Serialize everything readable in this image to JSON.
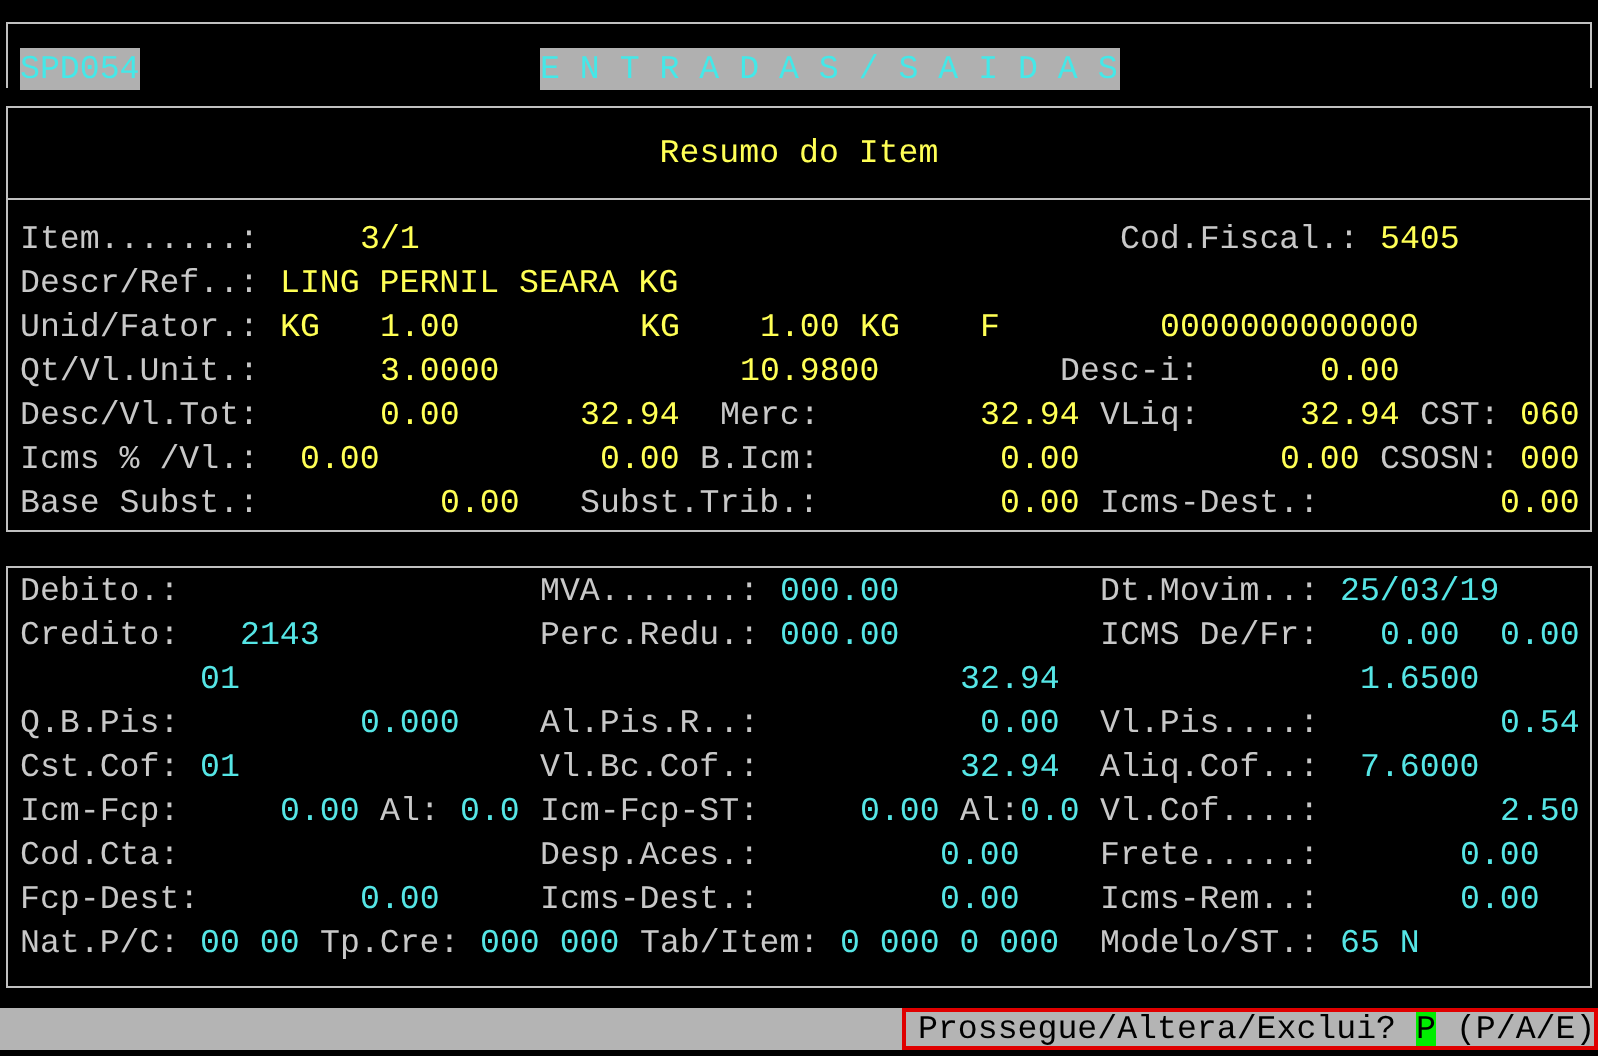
{
  "header": {
    "program_code": "SPD054",
    "title": "E N T R A D A S / S A I D A S"
  },
  "summary_title": "Resumo do Item",
  "sections": [
    {
      "kind": "summary",
      "lines": [
        {
          "left": [
            {
              "kind": "label",
              "text": "Item.......:"
            },
            {
              "kind": "value",
              "text": "3/1"
            }
          ],
          "right": [
            {
              "kind": "label",
              "text": "Cod.Fiscal.:"
            },
            {
              "kind": "value",
              "text": "5405"
            }
          ]
        },
        {
          "left": [
            {
              "kind": "label",
              "text": "Descr/Ref..:"
            },
            {
              "kind": "value",
              "text": "LING PERNIL SEARA KG"
            }
          ]
        },
        {
          "left": [
            {
              "kind": "label",
              "text": "Unid/Fator.:"
            },
            {
              "kind": "value",
              "text": "KG"
            },
            {
              "kind": "value",
              "text": "1.00"
            }
          ],
          "center": [
            {
              "kind": "value",
              "text": "KG"
            },
            {
              "kind": "value",
              "text": "1.00"
            },
            {
              "kind": "value",
              "text": "KG"
            }
          ],
          "right": [
            {
              "kind": "value",
              "text": "F"
            },
            {
              "kind": "value",
              "text": "0000000000000"
            }
          ]
        },
        {
          "left": [
            {
              "kind": "label",
              "text": "Qt/Vl.Unit.:"
            },
            {
              "kind": "value",
              "text": "3.0000"
            }
          ],
          "center": [
            {
              "kind": "value",
              "text": "10.9800"
            }
          ],
          "right": [
            {
              "kind": "label",
              "text": "Desc-i:"
            },
            {
              "kind": "value",
              "text": "0.00"
            }
          ]
        },
        {
          "left": [
            {
              "kind": "label",
              "text": "Desc/Vl.Tot:"
            },
            {
              "kind": "value",
              "text": "0.00"
            },
            {
              "kind": "value",
              "text": "32.94"
            }
          ],
          "center": [
            {
              "kind": "label",
              "text": "Merc:"
            },
            {
              "kind": "value",
              "text": "32.94"
            }
          ],
          "right": [
            {
              "kind": "label",
              "text": "VLiq:"
            },
            {
              "kind": "value",
              "text": "32.94"
            },
            {
              "kind": "label",
              "text": "CST:"
            },
            {
              "kind": "value",
              "text": "060"
            }
          ]
        },
        {
          "left": [
            {
              "kind": "label",
              "text": "Icms % /Vl.:"
            },
            {
              "kind": "value",
              "text": "0.00"
            },
            {
              "kind": "value",
              "text": "0.00"
            }
          ],
          "center": [
            {
              "kind": "label",
              "text": "B.Icm:"
            },
            {
              "kind": "value",
              "text": "0.00"
            }
          ],
          "right": [
            {
              "kind": "value",
              "text": "0.00"
            },
            {
              "kind": "label",
              "text": "CSOSN:"
            },
            {
              "kind": "value",
              "text": "000"
            }
          ]
        },
        {
          "left": [
            {
              "kind": "label",
              "text": "Base Subst.:"
            },
            {
              "kind": "value",
              "text": "0.00"
            }
          ],
          "center": [
            {
              "kind": "label",
              "text": "Subst.Trib.:"
            },
            {
              "kind": "value",
              "text": "0.00"
            }
          ],
          "right": [
            {
              "kind": "label",
              "text": "Icms-Dest.:"
            },
            {
              "kind": "value",
              "text": "0.00"
            }
          ]
        }
      ]
    },
    {
      "kind": "taxes",
      "lines": [
        {
          "left": [
            {
              "kind": "label",
              "text": "Debito.:"
            }
          ],
          "center": [
            {
              "kind": "label",
              "text": "MVA.......:"
            },
            {
              "kind": "value",
              "text": "000.00"
            }
          ],
          "right": [
            {
              "kind": "label",
              "text": "Dt.Movim..:"
            },
            {
              "kind": "value",
              "text": "25/03/19"
            }
          ]
        },
        {
          "left": [
            {
              "kind": "label",
              "text": "Credito:"
            },
            {
              "kind": "value",
              "text": "2143"
            }
          ],
          "center": [
            {
              "kind": "label",
              "text": "Perc.Redu.:"
            },
            {
              "kind": "value",
              "text": "000.00"
            }
          ],
          "right": [
            {
              "kind": "label",
              "text": "ICMS De/Fr:"
            },
            {
              "kind": "value",
              "text": "0.00"
            },
            {
              "kind": "value",
              "text": "0.00"
            }
          ]
        },
        {
          "left": [
            {
              "kind": "value",
              "text": "01"
            }
          ],
          "center": [
            {
              "kind": "value",
              "text": "32.94"
            }
          ],
          "right": [
            {
              "kind": "value",
              "text": "1.6500"
            }
          ]
        },
        {
          "left": [
            {
              "kind": "label",
              "text": "Q.B.Pis:"
            },
            {
              "kind": "value",
              "text": "0.000"
            }
          ],
          "center": [
            {
              "kind": "label",
              "text": "Al.Pis.R..:"
            },
            {
              "kind": "value",
              "text": "0.00"
            }
          ],
          "right": [
            {
              "kind": "label",
              "text": "Vl.Pis....:"
            },
            {
              "kind": "value",
              "text": "0.54"
            }
          ]
        },
        {
          "left": [
            {
              "kind": "label",
              "text": "Cst.Cof:"
            },
            {
              "kind": "value",
              "text": "01"
            }
          ],
          "center": [
            {
              "kind": "label",
              "text": "Vl.Bc.Cof.:"
            },
            {
              "kind": "value",
              "text": "32.94"
            }
          ],
          "right": [
            {
              "kind": "label",
              "text": "Aliq.Cof..:"
            },
            {
              "kind": "value",
              "text": "7.6000"
            }
          ]
        },
        {
          "left": [
            {
              "kind": "label",
              "text": "Icm-Fcp:"
            },
            {
              "kind": "value",
              "text": "0.00"
            },
            {
              "kind": "label",
              "text": "Al:"
            },
            {
              "kind": "value",
              "text": "0.0"
            }
          ],
          "center": [
            {
              "kind": "label",
              "text": "Icm-Fcp-ST:"
            },
            {
              "kind": "value",
              "text": "0.00"
            },
            {
              "kind": "label",
              "text": "Al:"
            },
            {
              "kind": "value",
              "text": "0.0"
            }
          ],
          "right": [
            {
              "kind": "label",
              "text": "Vl.Cof....:"
            },
            {
              "kind": "value",
              "text": "2.50"
            }
          ]
        },
        {
          "left": [
            {
              "kind": "label",
              "text": "Cod.Cta:"
            }
          ],
          "center": [
            {
              "kind": "label",
              "text": "Desp.Aces.:"
            },
            {
              "kind": "value",
              "text": "0.00"
            }
          ],
          "right": [
            {
              "kind": "label",
              "text": "Frete.....:"
            },
            {
              "kind": "value",
              "text": "0.00"
            }
          ]
        },
        {
          "left": [
            {
              "kind": "label",
              "text": "Fcp-Dest:"
            },
            {
              "kind": "value",
              "text": "0.00"
            }
          ],
          "center": [
            {
              "kind": "label",
              "text": "Icms-Dest.:"
            },
            {
              "kind": "value",
              "text": "0.00"
            }
          ],
          "right": [
            {
              "kind": "label",
              "text": "Icms-Rem..:"
            },
            {
              "kind": "value",
              "text": "0.00"
            }
          ]
        },
        {
          "left": [
            {
              "kind": "label",
              "text": "Nat.P/C:"
            },
            {
              "kind": "value",
              "text": "00 00"
            },
            {
              "kind": "label",
              "text": "Tp.Cre:"
            },
            {
              "kind": "value",
              "text": "000 000"
            }
          ],
          "center": [
            {
              "kind": "label",
              "text": "Tab/Item:"
            },
            {
              "kind": "value",
              "text": "0 000 0 000"
            }
          ],
          "right": [
            {
              "kind": "label",
              "text": "Modelo/ST.:"
            },
            {
              "kind": "value",
              "text": "65 N"
            }
          ]
        }
      ]
    }
  ],
  "prompt": {
    "question": "Prossegue/Altera/Exclui?",
    "answer": "P",
    "options": "(P/A/E)"
  }
}
